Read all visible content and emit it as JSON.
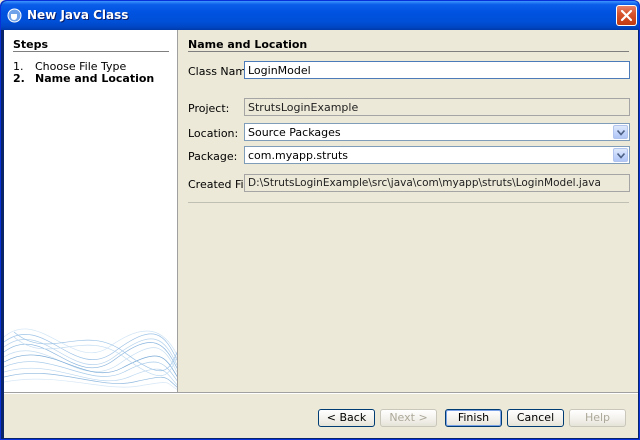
{
  "window": {
    "title": "New Java Class"
  },
  "steps": {
    "title": "Steps",
    "items": [
      {
        "num": "1.",
        "label": "Choose File Type"
      },
      {
        "num": "2.",
        "label": "Name and Location"
      }
    ]
  },
  "form": {
    "section_title": "Name and Location",
    "class_name_label": "Class Name:",
    "class_name_value": "LoginModel",
    "project_label": "Project:",
    "project_value": "StrutsLoginExample",
    "location_label": "Location:",
    "location_value": "Source Packages",
    "package_label": "Package:",
    "package_value": "com.myapp.struts",
    "created_file_label": "Created File:",
    "created_file_value": "D:\\StrutsLoginExample\\src\\java\\com\\myapp\\struts\\LoginModel.java"
  },
  "buttons": {
    "back": "< Back",
    "next": "Next >",
    "finish": "Finish",
    "cancel": "Cancel",
    "help": "Help"
  },
  "colors": {
    "titlebar": "#0052e0",
    "dialog_bg": "#ece9d8",
    "steps_bg": "#ffffff"
  }
}
